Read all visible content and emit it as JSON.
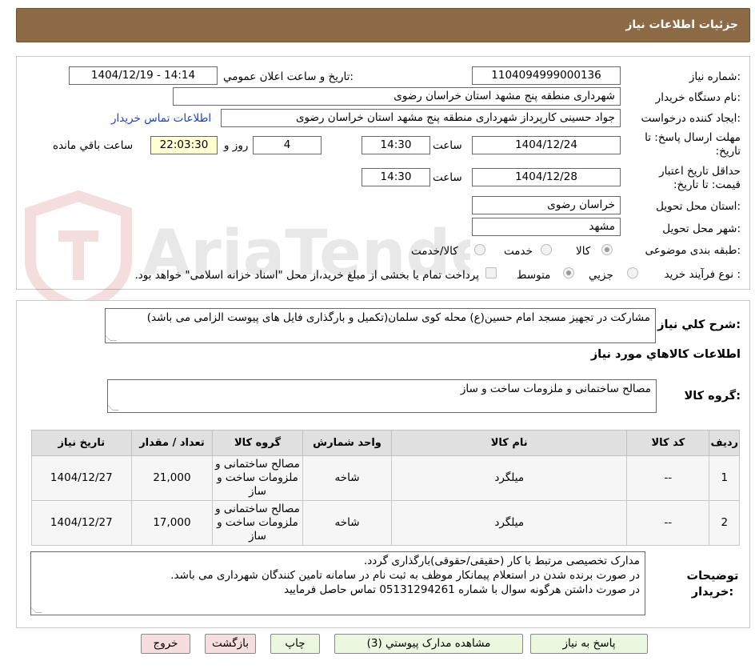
{
  "header": {
    "title": "جزئیات اطلاعات نیاز"
  },
  "watermark": {
    "text": "AriaTender.neT"
  },
  "form": {
    "need_number": {
      "label": "شماره نیاز:",
      "value": "1104094999000136"
    },
    "announce_datetime": {
      "label": "تاریخ و ساعت اعلان عمومي:",
      "value": "1404/12/19 - 14:14"
    },
    "buyer_org": {
      "label": "نام دستگاه خريدار:",
      "value": "شهرداری منطقه پنج مشهد استان خراسان رضوی"
    },
    "requester": {
      "label": "ايجاد کننده درخواست:",
      "value": "جواد حسینی کارپرداز شهرداری منطقه پنج مشهد استان خراسان رضوی"
    },
    "contact_link": "اطلاعات تماس خريدار",
    "reply_deadline": {
      "label": "مهلت ارسال پاسخ: تا تاريخ:",
      "date": "1404/12/24",
      "time_label": "ساعت",
      "time": "14:30",
      "days": "4",
      "days_label": "روز و",
      "remaining": "22:03:30",
      "remaining_label": "ساعت باقي مانده"
    },
    "price_validity": {
      "label": "حداقل تاريخ اعتبار قيمت: تا تاريخ:",
      "date": "1404/12/28",
      "time_label": "ساعت",
      "time": "14:30"
    },
    "province": {
      "label": "استان محل تحويل:",
      "value": "خراسان رضوی"
    },
    "city": {
      "label": "شهر محل تحويل:",
      "value": "مشهد"
    },
    "category": {
      "label": "طبقه بندی موضوعی:",
      "options": [
        "کالا",
        "خدمت",
        "کالا/خدمت"
      ],
      "selected": "کالا"
    },
    "process_type": {
      "label": "نوع فرآيند خريد :",
      "options": [
        "جزيي",
        "متوسط"
      ],
      "selected": "متوسط",
      "payment_note": "پرداخت تمام يا بخشی از مبلغ خريد،از محل \"اسناد خزانه اسلامی\" خواهد بود."
    }
  },
  "details": {
    "summary_label": "شرح کلي نياز:",
    "summary": "مشارکت در تجهیز مسجد امام حسین(ع) محله کوی سلمان(تکمیل و بارگذاری فایل های پیوست الزامی می باشد)",
    "goods_info_title": "اطلاعات کالاهاي مورد نياز",
    "goods_group_label": "گروه کالا:",
    "goods_group": "مصالح ساختمانی و ملزومات ساخت و ساز"
  },
  "table": {
    "headers": [
      "رديف",
      "کد کالا",
      "نام کالا",
      "واحد شمارش",
      "گروه کالا",
      "تعداد / مقدار",
      "تاريخ نياز"
    ],
    "rows": [
      {
        "row": "1",
        "code": "--",
        "name": "میلگرد",
        "unit": "شاخه",
        "group": "مصالح ساختمانی و ملزومات ساخت و ساز",
        "qty": "21,000",
        "date": "1404/12/27"
      },
      {
        "row": "2",
        "code": "--",
        "name": "میلگرد",
        "unit": "شاخه",
        "group": "مصالح ساختمانی و ملزومات ساخت و ساز",
        "qty": "17,000",
        "date": "1404/12/27"
      }
    ]
  },
  "buyer_notes": {
    "label": "توضيحات خريدار:",
    "lines": [
      "مدارک تخصیصی مرتبط با کار (حقیقی/حقوقی)بارگذاری گردد.",
      "در صورت برنده شدن در استعلام پیمانکار موظف به ثبت نام در سامانه تامین کنندگان شهرداری می باشد.",
      "در صورت داشتن هرگونه سوال  با شماره 05131294261 تماس حاصل فرمایید"
    ]
  },
  "buttons": {
    "reply": "پاسخ به نياز",
    "attachments": "مشاهده مدارک پيوستي (3)",
    "print": "چاپ",
    "back": "بازگشت",
    "exit": "خروج"
  },
  "colors": {
    "header": "#8c6a45",
    "button_green": "#ebf7df",
    "button_pink": "#f7dede",
    "link": "#1a3fd3"
  }
}
